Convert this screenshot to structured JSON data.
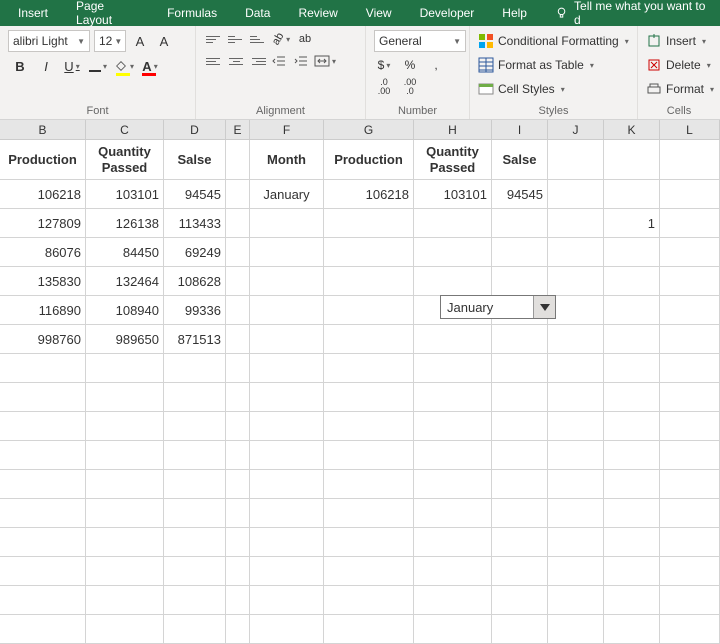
{
  "ribbon_tabs": [
    "Insert",
    "Page Layout",
    "Formulas",
    "Data",
    "Review",
    "View",
    "Developer",
    "Help"
  ],
  "tellme_placeholder": "Tell me what you want to d",
  "font": {
    "name": "alibri Light",
    "size": "12",
    "grow_label": "A",
    "shrink_label": "A",
    "bold": "B",
    "italic": "I",
    "underline": "U",
    "font_color_letter": "A",
    "group_label": "Font"
  },
  "alignment": {
    "wrap_label": "ab",
    "group_label": "Alignment"
  },
  "number": {
    "format": "General",
    "currency": "$",
    "percent": "%",
    "comma": ",",
    "inc_dec": ".0",
    "dec_inc": ".00",
    "inc_dec2": ".00",
    "dec_inc2": ".0",
    "group_label": "Number"
  },
  "styles": {
    "cond_fmt": "Conditional Formatting",
    "fmt_table": "Format as Table",
    "cell_styles": "Cell Styles",
    "group_label": "Styles"
  },
  "cells": {
    "insert": "Insert",
    "delete": "Delete",
    "format": "Format",
    "group_label": "Cells"
  },
  "columns": [
    "B",
    "C",
    "D",
    "E",
    "F",
    "G",
    "H",
    "I",
    "J",
    "K",
    "L"
  ],
  "headers_left": [
    "Production",
    "Quantity Passed",
    "Salse"
  ],
  "headers_right": [
    "Month",
    "Production",
    "Quantity Passed",
    "Salse"
  ],
  "data_left": [
    [
      "106218",
      "103101",
      "94545"
    ],
    [
      "127809",
      "126138",
      "113433"
    ],
    [
      "86076",
      "84450",
      "69249"
    ],
    [
      "135830",
      "132464",
      "108628"
    ],
    [
      "116890",
      "108940",
      "99336"
    ],
    [
      "998760",
      "989650",
      "871513"
    ]
  ],
  "data_right_row": [
    "January",
    "106218",
    "103101",
    "94545"
  ],
  "j_value": "1",
  "dropdown_value": "January"
}
